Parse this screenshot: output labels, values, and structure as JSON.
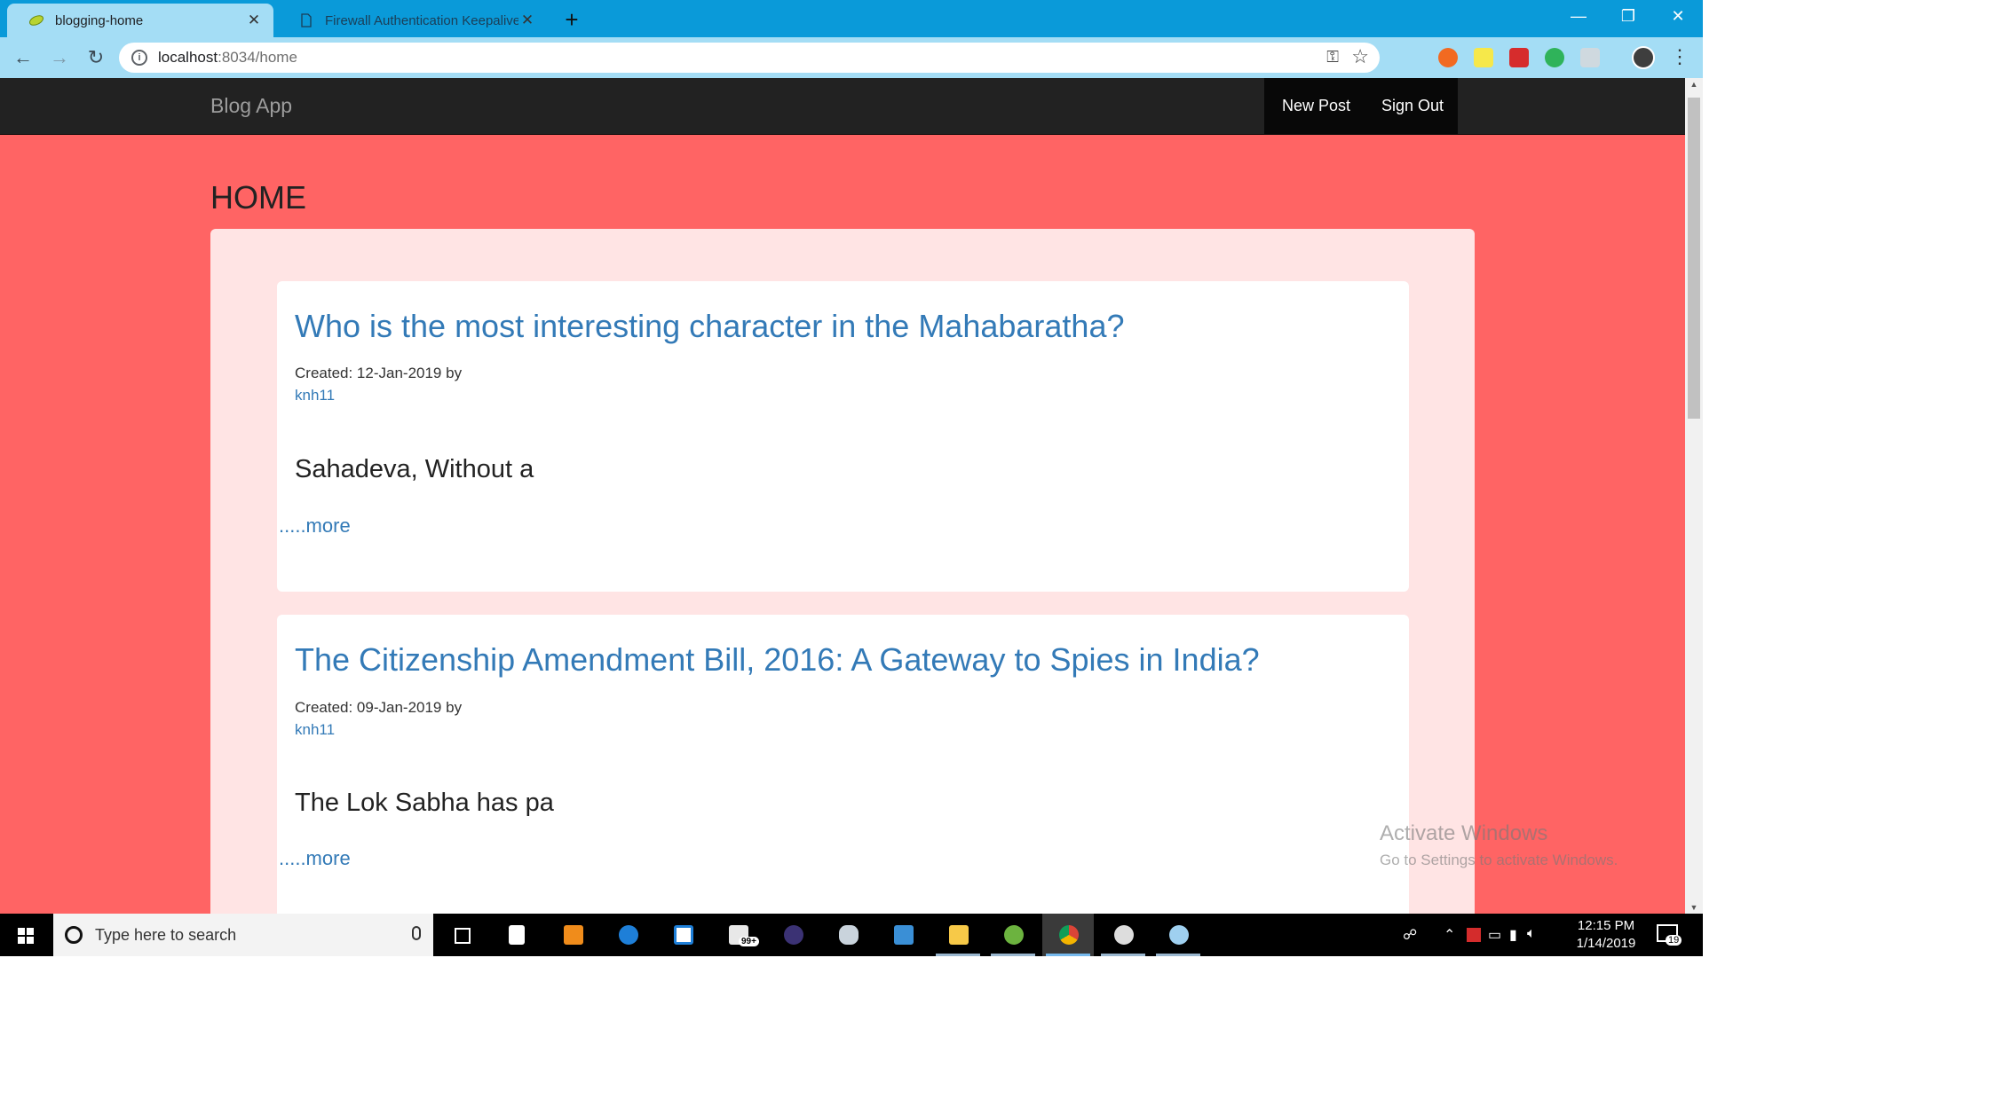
{
  "browser": {
    "tabs": [
      {
        "title": "blogging-home",
        "active": true
      },
      {
        "title": "Firewall Authentication Keepalive",
        "active": false
      }
    ],
    "new_tab_symbol": "+",
    "url_host": "localhost",
    "url_path": ":8034/home",
    "window_controls": {
      "minimize": "—",
      "maximize": "❐",
      "close": "✕"
    },
    "nav": {
      "back": "←",
      "forward": "→",
      "reload": "↻"
    },
    "icons": [
      "info-icon",
      "key-icon",
      "star-icon",
      "menu-dots-icon"
    ],
    "extension_count": "1"
  },
  "app": {
    "brand": "Blog App",
    "nav_links": {
      "new_post": "New Post",
      "sign_out": "Sign Out"
    },
    "page_heading": "HOME",
    "posts": [
      {
        "title": "Who is the most interesting character in the Mahabaratha?",
        "created": "Created: 12-Jan-2019 by",
        "author": "knh11",
        "excerpt": "Sahadeva, Without a",
        "more": ".....more"
      },
      {
        "title": "The Citizenship Amendment Bill, 2016: A Gateway to Spies in India?",
        "created": "Created: 09-Jan-2019 by",
        "author": "knh11",
        "excerpt": "The Lok Sabha has pa",
        "more": ".....more"
      }
    ],
    "colors": {
      "page_bg": "#ff6464",
      "panel_bg": "#ffe4e4",
      "link": "#337ab7",
      "navbar": "#222222"
    }
  },
  "watermark": {
    "title": "Activate Windows",
    "subtitle": "Go to Settings to activate Windows."
  },
  "taskbar": {
    "search_placeholder": "Type here to search",
    "mail_badge": "99+",
    "time": "12:15 PM",
    "date": "1/14/2019",
    "notification_count": "19",
    "apps": [
      "task-view-icon",
      "file-icon",
      "sublime-icon",
      "edge-icon",
      "store-icon",
      "mail-icon",
      "eclipse-icon",
      "db-icon",
      "remote-icon",
      "explorer-icon",
      "spring-icon",
      "chrome-icon",
      "settings-icon",
      "paint-icon"
    ]
  }
}
